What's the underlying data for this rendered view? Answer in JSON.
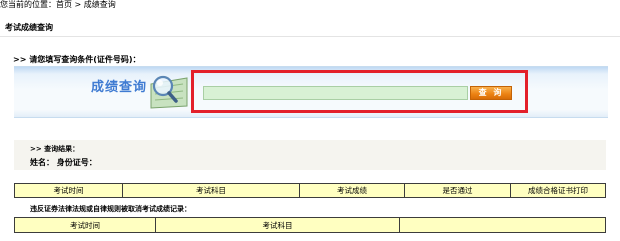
{
  "breadcrumb": {
    "prefix": "您当前的位置：",
    "home": "首页",
    "separator": " > ",
    "current": "成绩查询"
  },
  "page_title": "考试成绩查询",
  "query_prompt": ">> 请您填写查询条件(证件号码)：",
  "panel": {
    "title": "成绩查询",
    "icon": "magnifier-over-document-icon"
  },
  "id_input": {
    "value": "",
    "placeholder": ""
  },
  "query_button_label": "查 询",
  "results": {
    "heading": ">> 查询结果：",
    "name_label": "姓名：",
    "id_label": "身份证号：",
    "name_value": "",
    "id_value": ""
  },
  "score_table": {
    "columns": [
      "考试时间",
      "考试科目",
      "考试成绩",
      "是否通过",
      "成绩合格证书打印"
    ]
  },
  "violation": {
    "title": "违反证券法律法规或自律规则被取消考试成绩记录：",
    "columns": [
      "考试时间",
      "考试科目",
      ""
    ]
  },
  "colors": {
    "highlight_frame": "#e3202a",
    "panel_title": "#3f7bd2",
    "input_background": "#d8f1d4",
    "button": "#ec8212",
    "table_header": "#ffffc1"
  }
}
